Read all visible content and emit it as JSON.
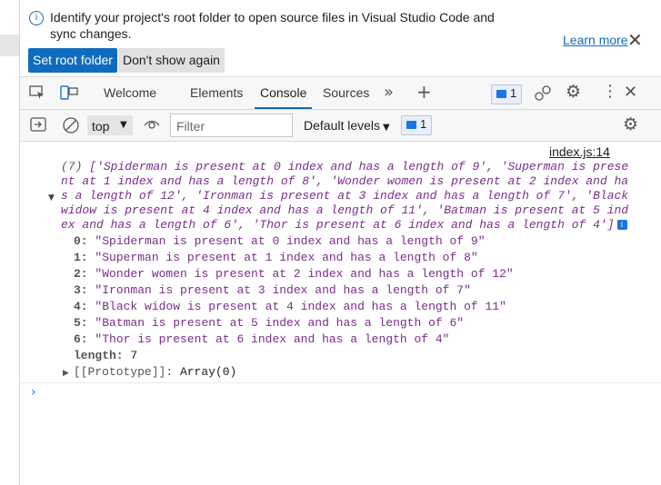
{
  "infobar": {
    "message": "Identify your project's root folder to open source files in Visual Studio Code and sync changes.",
    "learn_more": "Learn more",
    "set_root": "Set root folder",
    "dont_show": "Don't show again"
  },
  "tabs": [
    {
      "label": "Welcome"
    },
    {
      "label": "Elements"
    },
    {
      "label": "Console"
    },
    {
      "label": "Sources"
    }
  ],
  "active_tab": "Console",
  "issues_count": "1",
  "toolbar": {
    "context": "top",
    "filter_placeholder": "Filter",
    "levels": "Default levels",
    "message_count": "1"
  },
  "console": {
    "source": "index.js:14",
    "summary_count": "(7)",
    "summary": "['Spiderman is present at 0 index and has a length of 9', 'Superman is present at 1 index and has a length of 8', 'Wonder women is present at 2 index and has a length of 12', 'Ironman is present at 3 index and has a length of 7', 'Black widow is present at 4 index and has a length of 11', 'Batman is present at 5 index and has a length of 6', 'Thor is present at 6 index and has a length of 4']",
    "entries": [
      {
        "key": "0:",
        "value": "\"Spiderman is present at 0 index and has a length of 9\""
      },
      {
        "key": "1:",
        "value": "\"Superman is present at 1 index and has a length of 8\""
      },
      {
        "key": "2:",
        "value": "\"Wonder women is present at 2 index and has a length of 12\""
      },
      {
        "key": "3:",
        "value": "\"Ironman is present at 3 index and has a length of 7\""
      },
      {
        "key": "4:",
        "value": "\"Black widow is present at 4 index and has a length of 11\""
      },
      {
        "key": "5:",
        "value": "\"Batman is present at 5 index and has a length of 6\""
      },
      {
        "key": "6:",
        "value": "\"Thor is present at 6 index and has a length of 4\""
      }
    ],
    "length_key": "length:",
    "length_value": "7",
    "prototype_key": "[[Prototype]]:",
    "prototype_value": "Array(0)"
  }
}
